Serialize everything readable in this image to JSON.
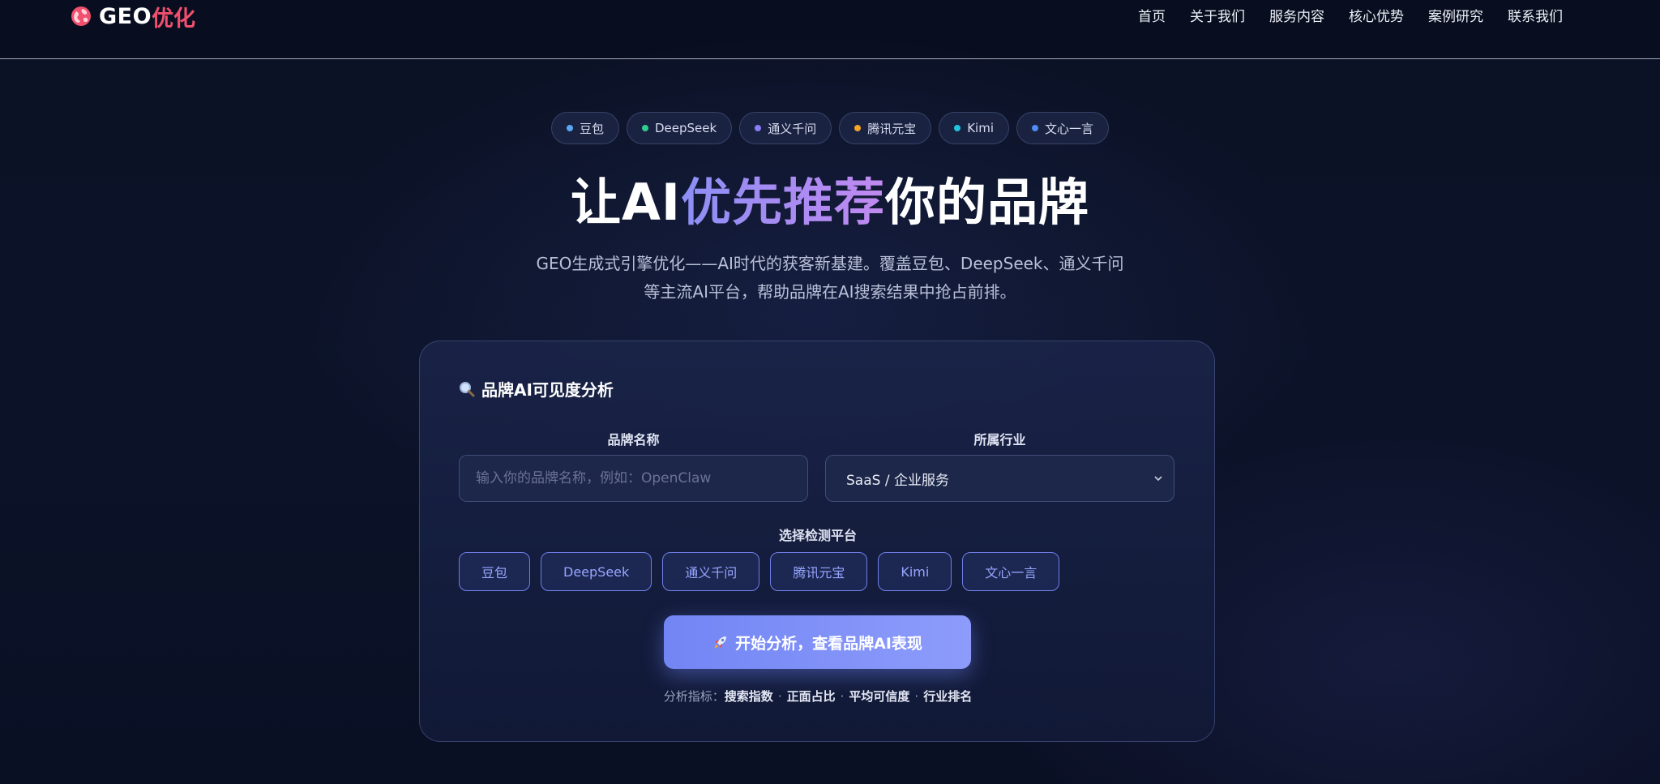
{
  "logo": {
    "text": "GEO",
    "accent": "优化"
  },
  "nav": {
    "items": [
      "首页",
      "关于我们",
      "服务内容",
      "核心优势",
      "案例研究",
      "联系我们"
    ]
  },
  "tags": [
    {
      "label": "豆包",
      "color": "#5aa8f5"
    },
    {
      "label": "DeepSeek",
      "color": "#2ecf8e"
    },
    {
      "label": "通义千问",
      "color": "#8b7cf7"
    },
    {
      "label": "腾讯元宝",
      "color": "#f5a524"
    },
    {
      "label": "Kimi",
      "color": "#22c3dd"
    },
    {
      "label": "文心一言",
      "color": "#4f8cf5"
    }
  ],
  "hero": {
    "title_pre": "让AI",
    "title_highlight": "优先推荐",
    "title_post": "你的品牌",
    "subtitle": "GEO生成式引擎优化——AI时代的获客新基建。覆盖豆包、DeepSeek、通义千问等主流AI平台，帮助品牌在AI搜索结果中抢占前排。"
  },
  "card": {
    "title": "品牌AI可见度分析",
    "brand_label": "品牌名称",
    "brand_placeholder": "输入你的品牌名称，例如：OpenClaw",
    "industry_label": "所属行业",
    "industry_value": "SaaS / 企业服务",
    "platform_label": "选择检测平台",
    "platforms": [
      "豆包",
      "DeepSeek",
      "通义千问",
      "腾讯元宝",
      "Kimi",
      "文心一言"
    ],
    "start_button": "开始分析，查看品牌AI表现",
    "metrics_prefix": "分析指标：",
    "metrics": [
      "搜索指数",
      "正面占比",
      "平均可信度",
      "行业排名"
    ]
  }
}
